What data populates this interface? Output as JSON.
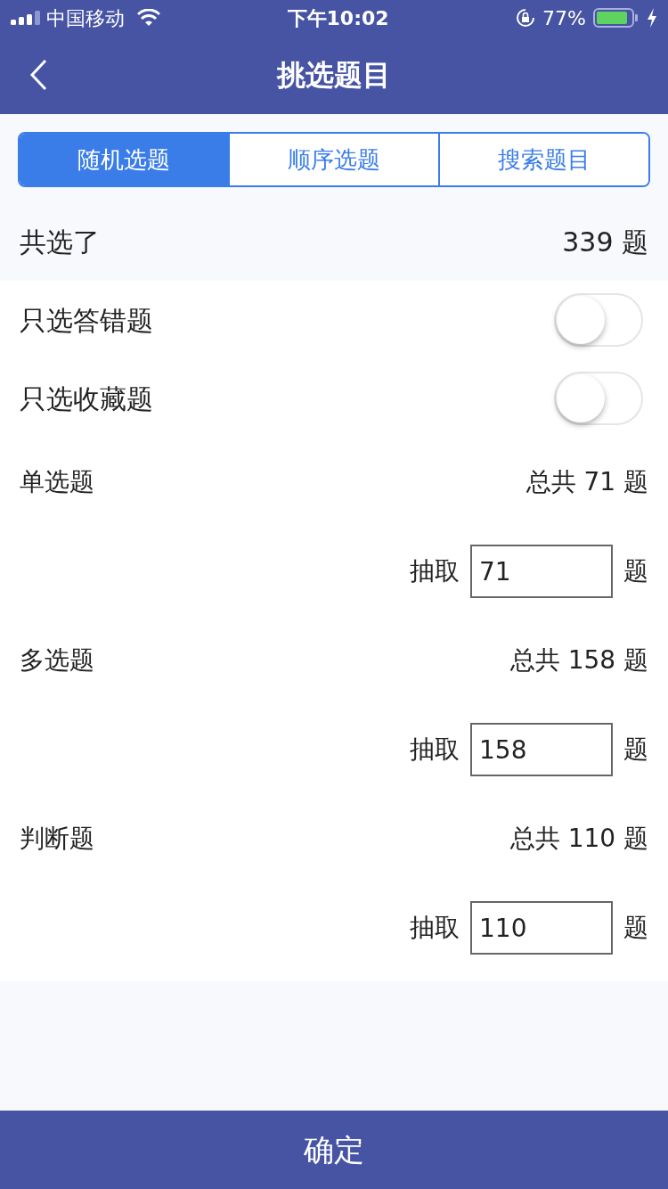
{
  "status_bar": {
    "carrier": "中国移动",
    "time": "下午10:02",
    "battery": "77%"
  },
  "nav": {
    "title": "挑选题目"
  },
  "tabs": [
    {
      "label": "随机选题",
      "selected": true
    },
    {
      "label": "顺序选题",
      "selected": false
    },
    {
      "label": "搜索题目",
      "selected": false
    }
  ],
  "summary": {
    "label": "共选了",
    "value": "339 题"
  },
  "switches": [
    {
      "label": "只选答错题",
      "on": false
    },
    {
      "label": "只选收藏题",
      "on": false
    }
  ],
  "question_types": [
    {
      "name": "单选题",
      "total": "总共 71 题",
      "extract_label": "抽取",
      "count": "71",
      "unit": "题"
    },
    {
      "name": "多选题",
      "total": "总共 158 题",
      "extract_label": "抽取",
      "count": "158",
      "unit": "题"
    },
    {
      "name": "判断题",
      "total": "总共 110 题",
      "extract_label": "抽取",
      "count": "110",
      "unit": "题"
    }
  ],
  "confirm_button": "确定"
}
